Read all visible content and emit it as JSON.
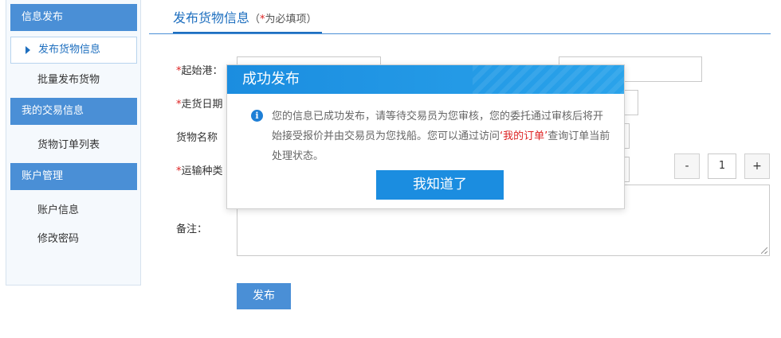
{
  "sidebar": {
    "sections": [
      {
        "title": "信息发布",
        "items": [
          "发布货物信息",
          "批量发布货物"
        ]
      },
      {
        "title": "我的交易信息",
        "items": [
          "货物订单列表"
        ]
      },
      {
        "title": "账户管理",
        "items": [
          "账户信息",
          "修改密码"
        ]
      }
    ]
  },
  "tab": {
    "title": "发布货物信息",
    "paren_open": "（",
    "star": "*",
    "req_text": "为必填项",
    "paren_close": "）"
  },
  "form": {
    "star": "*",
    "origin_label": "起始港：",
    "ship_date_label": "走货日期",
    "goods_name_label": "货物名称",
    "transport_label": "运输种类",
    "remark_label": "备注：",
    "qty_minus": "-",
    "qty_value": "1",
    "qty_plus": "+",
    "submit_label": "发布"
  },
  "modal": {
    "title": "成功发布",
    "icon": "info-icon",
    "msg_before": "您的信息已成功发布，请等待交易员为您审核，您的委托通过审核后将开始接受报价并由交易员为您找船。您可以通过访问",
    "msg_link": "‘我的订单’",
    "msg_after": "查询订单当前处理状态。",
    "ok_label": "我知道了"
  },
  "colors": {
    "accent": "#4a8fd6",
    "modal_header": "#1b8de0",
    "required": "#dd2222"
  }
}
